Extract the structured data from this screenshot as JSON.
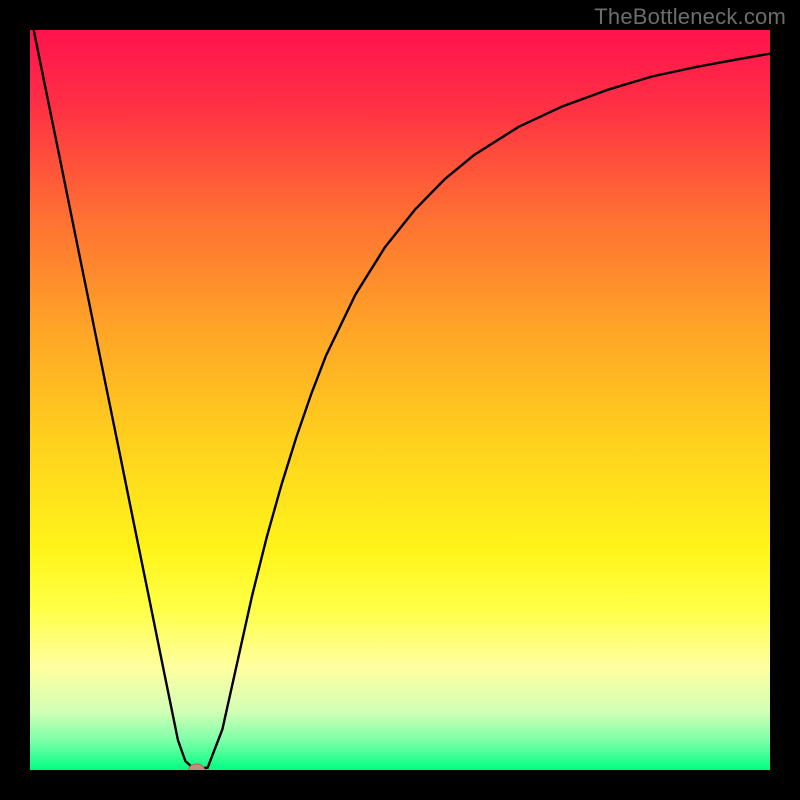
{
  "watermark": "TheBottleneck.com",
  "chart_data": {
    "type": "line",
    "title": "",
    "xlabel": "",
    "ylabel": "",
    "xlim": [
      0,
      100
    ],
    "ylim": [
      0,
      100
    ],
    "grid": false,
    "legend": false,
    "background_gradient": {
      "stops": [
        {
          "offset": 0.0,
          "color": "#ff134e"
        },
        {
          "offset": 0.1,
          "color": "#ff2f44"
        },
        {
          "offset": 0.25,
          "color": "#ff6f33"
        },
        {
          "offset": 0.4,
          "color": "#ffa327"
        },
        {
          "offset": 0.55,
          "color": "#ffcf1e"
        },
        {
          "offset": 0.7,
          "color": "#fff41a"
        },
        {
          "offset": 0.78,
          "color": "#ffff45"
        },
        {
          "offset": 0.86,
          "color": "#ffff9f"
        },
        {
          "offset": 0.92,
          "color": "#d3ffb6"
        },
        {
          "offset": 0.96,
          "color": "#7dffa8"
        },
        {
          "offset": 1.0,
          "color": "#00ff83"
        }
      ]
    },
    "series": [
      {
        "name": "bottleneck-curve",
        "color": "#000000",
        "x": [
          0.5,
          2,
          4,
          6,
          8,
          10,
          12,
          14,
          16,
          18,
          19,
          20,
          21,
          22,
          23,
          24,
          26,
          28,
          30,
          32,
          34,
          36,
          38,
          40,
          44,
          48,
          52,
          56,
          60,
          66,
          72,
          78,
          84,
          90,
          96,
          100
        ],
        "y": [
          100,
          92.6,
          82.8,
          72.9,
          63.1,
          53.2,
          43.4,
          33.5,
          23.7,
          13.8,
          8.9,
          4,
          1.2,
          0.3,
          0.3,
          0.3,
          5.5,
          14.5,
          23.5,
          31.5,
          38.6,
          45,
          50.8,
          56,
          64.3,
          70.7,
          75.7,
          79.8,
          83.1,
          86.9,
          89.7,
          91.9,
          93.7,
          95,
          96.1,
          96.8
        ]
      }
    ],
    "marker": {
      "name": "selected-point",
      "x": 22.5,
      "y": 0,
      "color_fill": "#c58b7e",
      "color_stroke": "#a36a5d",
      "rx": 8,
      "ry": 6
    }
  }
}
